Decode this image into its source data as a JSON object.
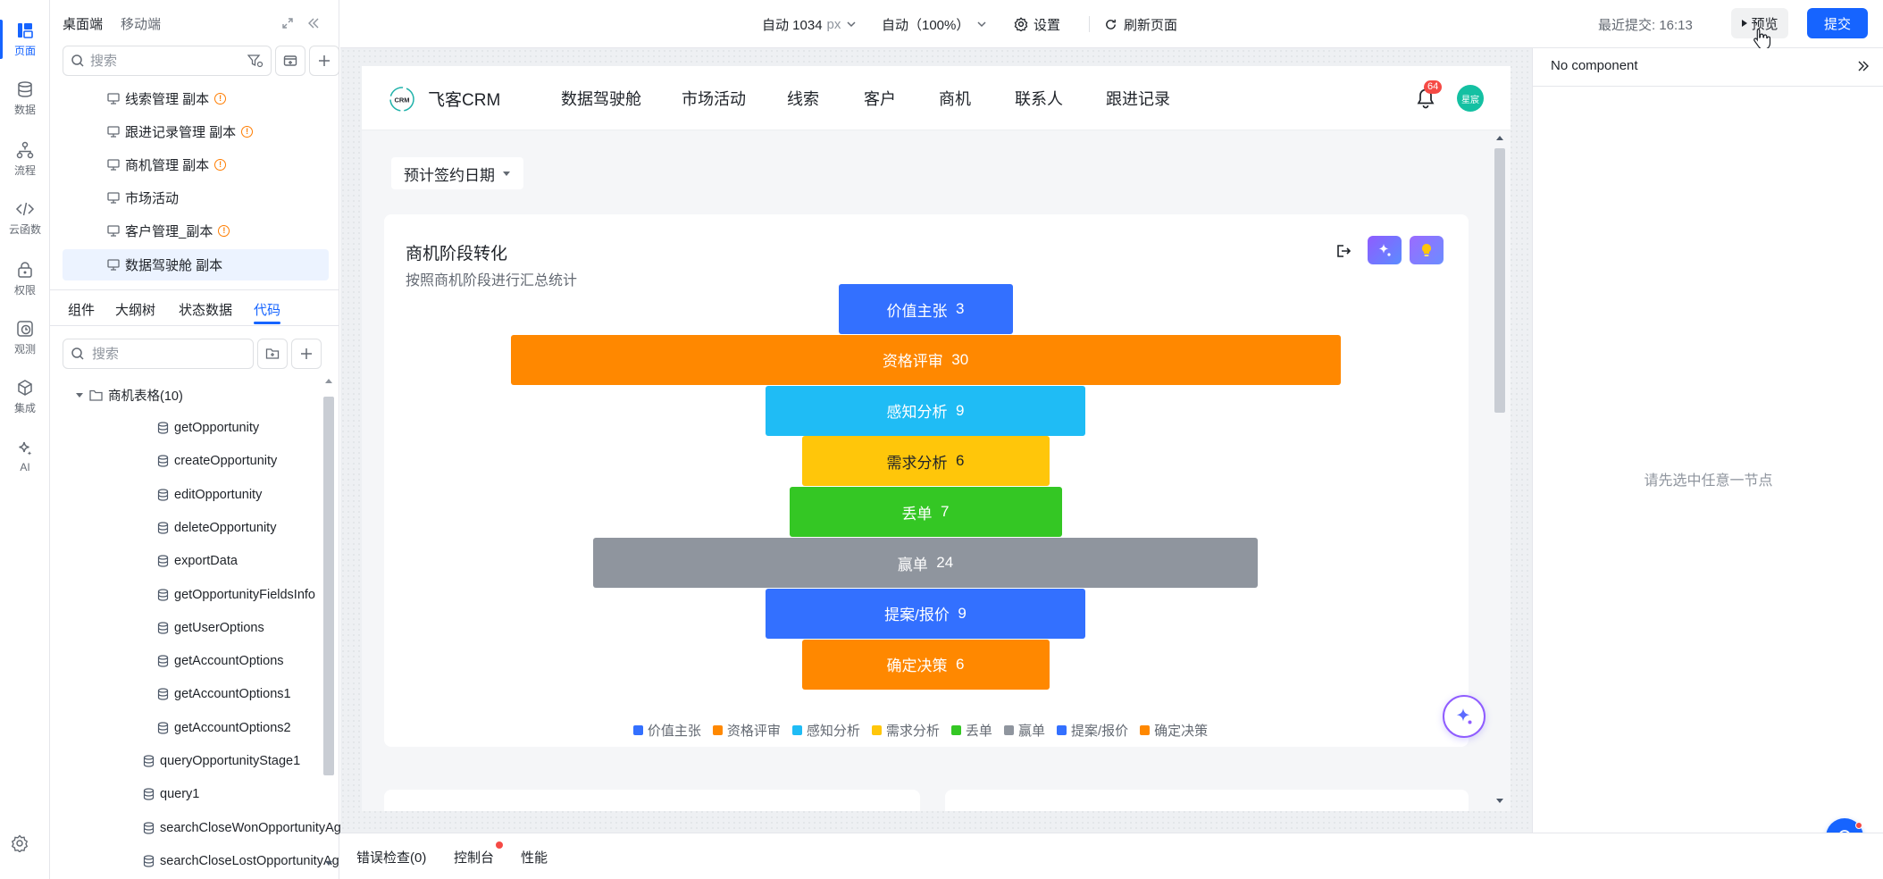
{
  "rail": [
    {
      "label": "页面",
      "icon": "layout-icon"
    },
    {
      "label": "数据",
      "icon": "database-icon"
    },
    {
      "label": "流程",
      "icon": "flow-icon"
    },
    {
      "label": "云函数",
      "icon": "code-icon"
    },
    {
      "label": "权限",
      "icon": "lock-icon"
    },
    {
      "label": "观测",
      "icon": "clock-icon"
    },
    {
      "label": "集成",
      "icon": "cube-icon"
    },
    {
      "label": "AI",
      "icon": "sparkle-icon"
    }
  ],
  "left": {
    "platform_tabs": [
      "桌面端",
      "移动端"
    ],
    "search_placeholder": "搜索",
    "pages": [
      {
        "label": "线索管理 副本",
        "warn": true
      },
      {
        "label": "跟进记录管理 副本",
        "warn": true
      },
      {
        "label": "商机管理 副本",
        "warn": true
      },
      {
        "label": "市场活动",
        "warn": false
      },
      {
        "label": "客户管理_副本",
        "warn": true
      },
      {
        "label": "数据驾驶舱 副本",
        "warn": false
      }
    ],
    "sub_tabs": [
      "组件",
      "大纲树",
      "状态数据",
      "代码"
    ],
    "code_search_placeholder": "搜索",
    "folder": "商机表格(10)",
    "apis": [
      "getOpportunity",
      "createOpportunity",
      "editOpportunity",
      "deleteOpportunity",
      "exportData",
      "getOpportunityFieldsInfo",
      "getUserOptions",
      "getAccountOptions",
      "getAccountOptions1",
      "getAccountOptions2"
    ],
    "queries": [
      "queryOpportunityStage1",
      "query1",
      "searchCloseWonOpportunityAg...",
      "searchCloseLostOpportunityAg..."
    ]
  },
  "topbar": {
    "width_label": "自动 1034",
    "width_unit": "px",
    "zoom_label": "自动（100%）",
    "settings": "设置",
    "refresh": "刷新页面",
    "last_submit": "最近提交:  16:13",
    "preview": "预览",
    "submit": "提交"
  },
  "app": {
    "logo_text": "飞客CRM",
    "logo_badge": "CRM",
    "nav": [
      "数据驾驶舱",
      "市场活动",
      "线索",
      "客户",
      "商机",
      "联系人",
      "跟进记录"
    ],
    "notification_count": "64",
    "avatar_text": "星宸",
    "date_filter": "预计签约日期",
    "card_title": "商机阶段转化",
    "card_subtitle": "按照商机阶段进行汇总统计"
  },
  "chart_data": {
    "type": "funnel",
    "title": "商机阶段转化",
    "subtitle": "按照商机阶段进行汇总统计",
    "categories": [
      "价值主张",
      "资格评审",
      "感知分析",
      "需求分析",
      "丢单",
      "赢单",
      "提案/报价",
      "确定决策"
    ],
    "values": [
      3,
      30,
      9,
      6,
      7,
      24,
      9,
      6
    ],
    "colors": [
      "#3370ff",
      "#ff8800",
      "#1fbcf5",
      "#ffc60a",
      "#34c724",
      "#8f959e",
      "#3370ff",
      "#ff8800"
    ],
    "label_colors": [
      "#ffffff",
      "#ffffff",
      "#ffffff",
      "#1f2329",
      "#ffffff",
      "#ffffff",
      "#ffffff",
      "#ffffff"
    ],
    "legend": [
      "价值主张",
      "资格评审",
      "感知分析",
      "需求分析",
      "丢单",
      "赢单",
      "提案/报价",
      "确定决策"
    ],
    "legend_position": "bottom"
  },
  "right": {
    "title": "No component",
    "empty_text": "请先选中任意一节点"
  },
  "bottom": {
    "tabs": [
      "错误检查(0)",
      "控制台",
      "性能"
    ]
  }
}
